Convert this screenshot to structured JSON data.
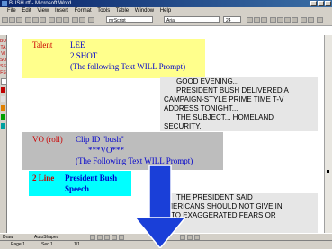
{
  "window": {
    "title": "BUSH.rtf - Microsoft Word"
  },
  "menu": [
    "File",
    "Edit",
    "View",
    "Insert",
    "Format",
    "Tools",
    "Table",
    "Window",
    "Help"
  ],
  "toolbar": {
    "style_value": "mrScript",
    "font_value": "Arial",
    "size_value": "24"
  },
  "left_margin_labels": [
    "BU",
    "TA",
    "VI",
    "SO",
    "SS",
    "FS"
  ],
  "blocks": {
    "talent": {
      "label": "Talent",
      "name": "LEE",
      "shot": "2 SHOT",
      "note": "(The following Text WILL Prompt)"
    },
    "prompt1": [
      "GOOD EVENING...",
      "PRESIDENT BUSH DELIVERED A",
      "CAMPAIGN-STYLE PRIME TIME T-V",
      "ADDRESS TONIGHT...",
      "THE SUBJECT... HOMELAND",
      "SECURITY."
    ],
    "vo": {
      "label": "VO (roll)",
      "clip": "Clip ID \"bush\"",
      "marker": "***VO***",
      "note": "(The Following Text WILL Prompt)"
    },
    "super": {
      "label": "2 Line",
      "line1": "President Bush",
      "line2": "Speech"
    },
    "prompt2": [
      "THE PRESIDENT SAID",
      "AMERICANS SHOULD NOT GIVE IN",
      "TO EXAGGERATED FEARS OR"
    ]
  },
  "drawbar": {
    "draw": "Draw",
    "autoshapes": "AutoShapes"
  },
  "status": {
    "page": "Page 1",
    "sec": "Sec 1",
    "pages": "1/1"
  },
  "colors": {
    "talent_bg": "#ffff8c",
    "vo_bg": "#bdbdbd",
    "super_bg": "#00ffff",
    "arrow": "#1a3fd8"
  }
}
